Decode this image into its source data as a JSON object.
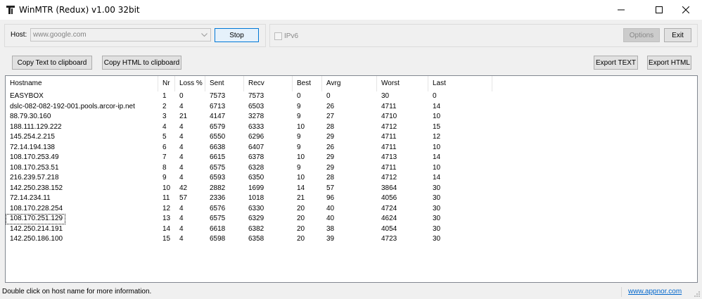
{
  "window": {
    "title": "WinMTR (Redux) v1.00 32bit"
  },
  "controls": {
    "host_label": "Host:",
    "host_value": "www.google.com",
    "stop_label": "Stop",
    "ipv6_label": "IPv6",
    "options_label": "Options",
    "exit_label": "Exit",
    "copy_text_label": "Copy Text to clipboard",
    "copy_html_label": "Copy HTML to clipboard",
    "export_text_label": "Export TEXT",
    "export_html_label": "Export HTML"
  },
  "table": {
    "columns": [
      "Hostname",
      "Nr",
      "Loss %",
      "Sent",
      "Recv",
      "Best",
      "Avrg",
      "Worst",
      "Last"
    ],
    "rows": [
      [
        "EASYBOX",
        "1",
        "0",
        "7573",
        "7573",
        "0",
        "0",
        "30",
        "0"
      ],
      [
        "dslc-082-082-192-001.pools.arcor-ip.net",
        "2",
        "4",
        "6713",
        "6503",
        "9",
        "26",
        "4711",
        "14"
      ],
      [
        "88.79.30.160",
        "3",
        "21",
        "4147",
        "3278",
        "9",
        "27",
        "4710",
        "10"
      ],
      [
        "188.111.129.222",
        "4",
        "4",
        "6579",
        "6333",
        "10",
        "28",
        "4712",
        "15"
      ],
      [
        "145.254.2.215",
        "5",
        "4",
        "6550",
        "6296",
        "9",
        "29",
        "4711",
        "12"
      ],
      [
        "72.14.194.138",
        "6",
        "4",
        "6638",
        "6407",
        "9",
        "26",
        "4711",
        "10"
      ],
      [
        "108.170.253.49",
        "7",
        "4",
        "6615",
        "6378",
        "10",
        "29",
        "4713",
        "14"
      ],
      [
        "108.170.253.51",
        "8",
        "4",
        "6575",
        "6328",
        "9",
        "29",
        "4711",
        "10"
      ],
      [
        "216.239.57.218",
        "9",
        "4",
        "6593",
        "6350",
        "10",
        "28",
        "4712",
        "14"
      ],
      [
        "142.250.238.152",
        "10",
        "42",
        "2882",
        "1699",
        "14",
        "57",
        "3864",
        "30"
      ],
      [
        "72.14.234.11",
        "11",
        "57",
        "2336",
        "1018",
        "21",
        "96",
        "4056",
        "30"
      ],
      [
        "108.170.228.254",
        "12",
        "4",
        "6576",
        "6330",
        "20",
        "40",
        "4724",
        "30"
      ],
      [
        "108.170.251.129",
        "13",
        "4",
        "6575",
        "6329",
        "20",
        "40",
        "4624",
        "30"
      ],
      [
        "142.250.214.191",
        "14",
        "4",
        "6618",
        "6382",
        "20",
        "38",
        "4054",
        "30"
      ],
      [
        "142.250.186.100",
        "15",
        "4",
        "6598",
        "6358",
        "20",
        "39",
        "4723",
        "30"
      ]
    ],
    "focused_row": 12
  },
  "status": {
    "text": "Double click on host name for more information.",
    "link": "www.appnor.com"
  }
}
